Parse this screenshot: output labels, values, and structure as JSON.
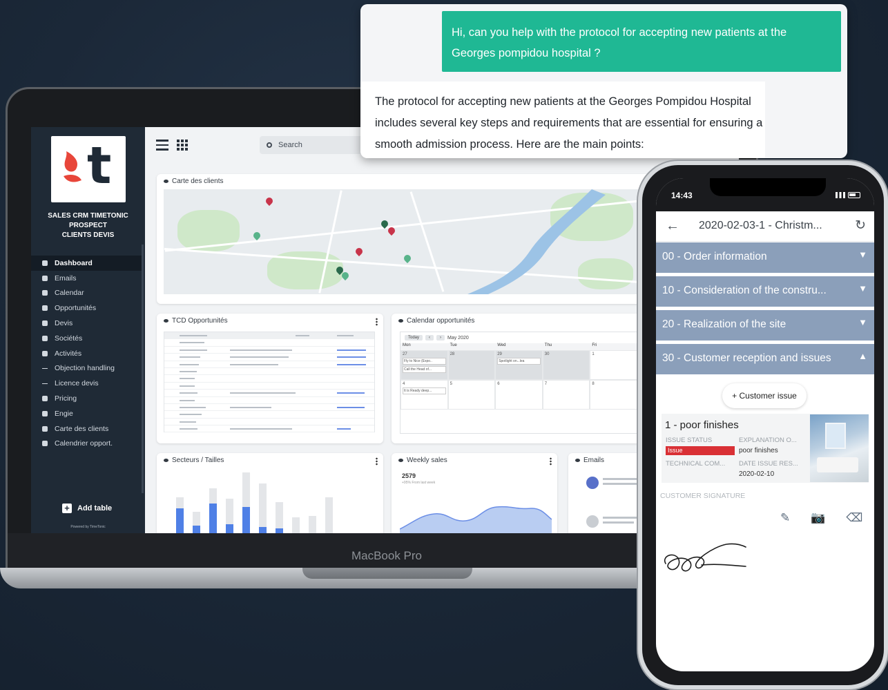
{
  "chat": {
    "user_message": "Hi, can you help with the protocol for accepting new patients at the Georges pompidou hospital ?",
    "bot_message": "The protocol for accepting new patients at the Georges Pompidou Hospital includes several key steps and requirements that are essential for ensuring a smooth admission process. Here are the main points:"
  },
  "laptop": {
    "brand_label": "MacBook Pro",
    "logo_letter": "t",
    "app_title_lines": [
      "SALES CRM TIMETONIC",
      "PROSPECT",
      "CLIENTS DEVIS"
    ],
    "search_placeholder": "Search",
    "sidebar": {
      "items": [
        {
          "label": "Dashboard",
          "active": true
        },
        {
          "label": "Emails"
        },
        {
          "label": "Calendar"
        },
        {
          "label": "Opportunités"
        },
        {
          "label": "Devis"
        },
        {
          "label": "Sociétés"
        },
        {
          "label": "Activités"
        },
        {
          "label": "Objection handling"
        },
        {
          "label": "Licence devis"
        },
        {
          "label": "Pricing"
        },
        {
          "label": "Engie"
        },
        {
          "label": "Carte des clients"
        },
        {
          "label": "Calendrier opport."
        }
      ],
      "add_table_label": "Add table",
      "powered_label": "Powered by TimeTonic"
    },
    "cards": {
      "map_title": "Carte des clients",
      "tcd_title": "TCD Opportunités",
      "calendar_title": "Calendar opportunités",
      "calendar_month": "May 2020",
      "calendar_today": "Today",
      "calendar_days": [
        "Mon",
        "Tue",
        "Wed",
        "Thu",
        "Fri"
      ],
      "calendar_dates_row1": [
        "27",
        "28",
        "29",
        "30",
        "1"
      ],
      "calendar_dates_row2": [
        "4",
        "5",
        "6",
        "7",
        "8"
      ],
      "calendar_events": [
        "Fly to Nice (Expo..",
        "Call the Head of...",
        "Spotlight on...lea",
        "It is Ready deep..."
      ],
      "sectors_title": "Secteurs / Tailles",
      "weekly_title": "Weekly sales",
      "weekly_value": "2579",
      "weekly_sub": "+95% From last week",
      "emails_title": "Emails",
      "bar_values": [
        {
          "grey": 0.58,
          "blue": 0.4
        },
        {
          "grey": 0.35,
          "blue": 0.12
        },
        {
          "grey": 0.72,
          "blue": 0.48
        },
        {
          "grey": 0.55,
          "blue": 0.14
        },
        {
          "grey": 0.98,
          "blue": 0.42
        },
        {
          "grey": 0.8,
          "blue": 0.1
        },
        {
          "grey": 0.5,
          "blue": 0.08
        },
        {
          "grey": 0.25,
          "blue": 0
        },
        {
          "grey": 0.28,
          "blue": 0
        },
        {
          "grey": 0.58,
          "blue": 0
        }
      ],
      "colors": {
        "blue": "#4f80e6",
        "grey": "#e4e6e9"
      }
    }
  },
  "phone": {
    "time": "14:43",
    "header_title": "2020-02-03-1 - Christm...",
    "sections": [
      {
        "label": "00 - Order information",
        "chevron": "down"
      },
      {
        "label": "10 - Consideration of the constru...",
        "chevron": "down"
      },
      {
        "label": "20 - Realization of the site",
        "chevron": "down"
      },
      {
        "label": "30 - Customer reception and issues",
        "chevron": "up"
      }
    ],
    "customer_issue_button": "+ Customer issue",
    "issue": {
      "title": "1 - poor finishes",
      "status_label": "ISSUE STATUS",
      "status_value": "Issue",
      "explanation_label": "EXPLANATION O...",
      "explanation_value": "poor finishes",
      "technical_label": "TECHNICAL COM...",
      "date_label": "DATE ISSUE RES...",
      "date_value": "2020-02-10"
    },
    "signature_label": "CUSTOMER SIGNATURE",
    "colors": {
      "section_bg": "#8b9fba",
      "status_red": "#d93035"
    }
  }
}
